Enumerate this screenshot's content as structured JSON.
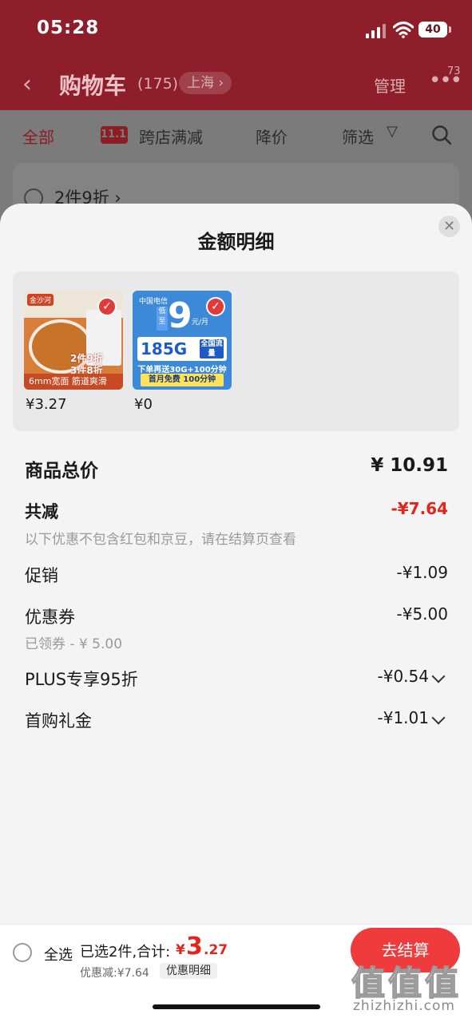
{
  "status_bar": {
    "time": "05:28",
    "battery": "40"
  },
  "header": {
    "back_icon": "chevron-left-icon",
    "title": "购物车",
    "count": "(175)",
    "location": "上海 ›",
    "manage": "管理",
    "more_badge": "73"
  },
  "filter_tabs": {
    "all": "全部",
    "tag_11": "11.11",
    "cross_store": "跨店满减",
    "price_drop": "降价",
    "filter": "筛选",
    "filter_icon": "funnel-icon",
    "search_icon": "search-icon"
  },
  "background_card": {
    "text": "2件9折 ›"
  },
  "sheet": {
    "title": "金额明细",
    "close_icon": "close-icon",
    "items": [
      {
        "price": "¥3.27",
        "brand": "金沙河",
        "promo_line1": "2件9折",
        "promo_line2": "3件8折",
        "caption": "6mm宽面  筋道爽滑"
      },
      {
        "price": "¥0",
        "brand": "中国电信",
        "low": "低至",
        "big_number": "9",
        "unit": "元/月",
        "data_plan": "185G",
        "plan_tag": "全国流量",
        "line": "下单再送30G+100分钟",
        "yellow": "首月免费 100分钟"
      }
    ],
    "total": {
      "label": "商品总价",
      "value": "¥ 10.91"
    },
    "reduction": {
      "label": "共减",
      "value": "-¥7.64",
      "note": "以下优惠不包含红包和京豆，请在结算页查看"
    },
    "promotion": {
      "label": "促销",
      "value": "-¥1.09"
    },
    "coupon": {
      "label": "优惠券",
      "value": "-¥5.00",
      "note": "已领券 - ¥ 5.00"
    },
    "plus": {
      "label": "PLUS专享95折",
      "value": "-¥0.54"
    },
    "first_gift": {
      "label": "首购礼金",
      "value": "-¥1.01"
    }
  },
  "bottom_bar": {
    "select_all": "全选",
    "selected": "已选2件,合计:",
    "yen": "¥",
    "amount_int": "3",
    "amount_dec": ".27",
    "discount": "优惠减:¥7.64",
    "detail": "优惠明细",
    "checkout": "去结算"
  },
  "watermark": {
    "chars": [
      "值",
      "值",
      "值"
    ],
    "url": "zhizhizhi.com"
  },
  "colors": {
    "accent_red": "#e1251b",
    "header_dark": "#8e1e29",
    "checkout": "#ef3b3b"
  }
}
